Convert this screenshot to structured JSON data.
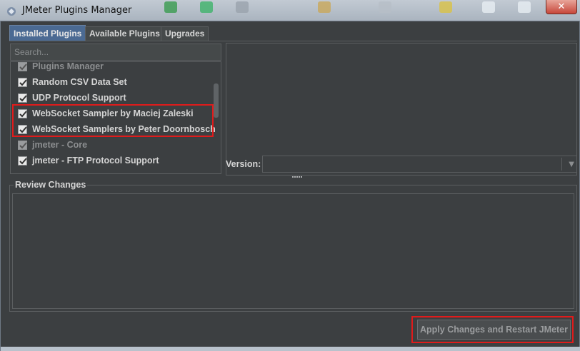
{
  "window": {
    "title": "JMeter Plugins Manager",
    "close_label": "✕"
  },
  "tabs": [
    {
      "label": "Installed Plugins",
      "active": true
    },
    {
      "label": "Available Plugins",
      "active": false
    },
    {
      "label": "Upgrades",
      "active": false
    }
  ],
  "search": {
    "placeholder": "Search..."
  },
  "plugins": [
    {
      "label": "Plugins Manager",
      "checked": true,
      "disabled": true
    },
    {
      "label": "Random CSV Data Set",
      "checked": true,
      "disabled": false
    },
    {
      "label": "UDP Protocol Support",
      "checked": true,
      "disabled": false
    },
    {
      "label": "WebSocket Sampler by Maciej Zaleski",
      "checked": true,
      "disabled": false
    },
    {
      "label": "WebSocket Samplers by Peter Doornbosch",
      "checked": true,
      "disabled": false
    },
    {
      "label": "jmeter - Core",
      "checked": true,
      "disabled": true
    },
    {
      "label": "jmeter - FTP Protocol Support",
      "checked": true,
      "disabled": false
    }
  ],
  "details": {
    "version_label": "Version:",
    "version_value": ""
  },
  "review": {
    "title": "Review Changes",
    "content": ""
  },
  "actions": {
    "apply_label": "Apply Changes and Restart JMeter"
  },
  "colors": {
    "background": "#3c3f41",
    "active_tab": "#4b6a93",
    "highlight": "#e01b1b"
  }
}
